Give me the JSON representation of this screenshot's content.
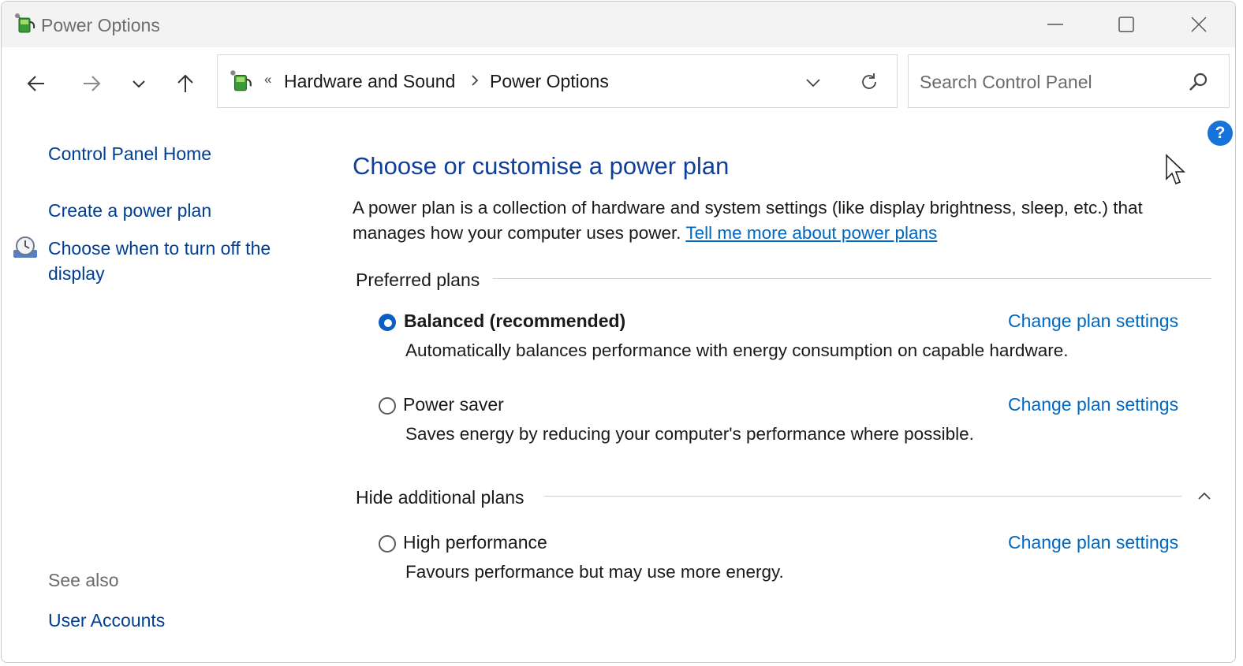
{
  "window": {
    "title": "Power Options",
    "controls": {
      "minimize": "minimize",
      "maximize": "maximize",
      "close": "close"
    }
  },
  "nav": {
    "breadcrumb_overflow": "«",
    "breadcrumbs": [
      "Hardware and Sound",
      "Power Options"
    ],
    "search_placeholder": "Search Control Panel"
  },
  "left_pane": {
    "home": "Control Panel Home",
    "create_plan": "Create a power plan",
    "display_off": "Choose when to turn off the display",
    "see_also_heading": "See also",
    "user_accounts": "User Accounts"
  },
  "main": {
    "title": "Choose or customise a power plan",
    "intro": "A power plan is a collection of hardware and system settings (like display brightness, sleep, etc.) that manages how your computer uses power.",
    "intro_link": "Tell me more about power plans",
    "preferred_heading": "Preferred plans",
    "additional_heading": "Hide additional plans",
    "change_label": "Change plan settings",
    "plans": [
      {
        "name": "Balanced (recommended)",
        "description": "Automatically balances performance with energy consumption on capable hardware.",
        "selected": true
      },
      {
        "name": "Power saver",
        "description": "Saves energy by reducing your computer's performance where possible.",
        "selected": false
      },
      {
        "name": "High performance",
        "description": "Favours performance but may use more energy.",
        "selected": false
      }
    ]
  },
  "help_glyph": "?",
  "colors": {
    "link": "#0067c0",
    "title_blue": "#0f3f9a",
    "radio_selected": "#0a5ec4",
    "help_badge": "#1673d9"
  }
}
